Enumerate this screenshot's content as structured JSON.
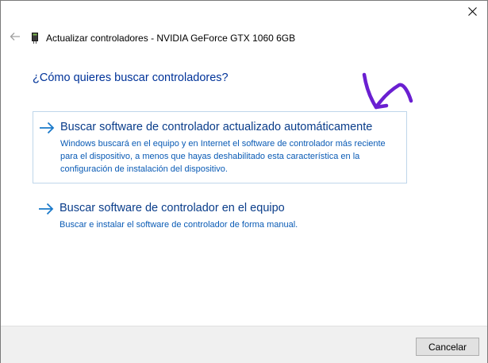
{
  "window": {
    "title": "Actualizar controladores - NVIDIA GeForce GTX 1060 6GB"
  },
  "icons": {
    "close": "close-icon",
    "back": "back-arrow-icon",
    "device": "device-driver-icon",
    "option_arrow": "right-arrow-icon",
    "annotation": "hand-drawn-arrow-annotation"
  },
  "main": {
    "question": "¿Cómo quieres buscar controladores?",
    "options": [
      {
        "title": "Buscar software de controlador actualizado automáticamente",
        "description": "Windows buscará en el equipo y en Internet el software de controlador más reciente para el dispositivo, a menos que hayas deshabilitado esta característica en la configuración de instalación del dispositivo."
      },
      {
        "title": "Buscar software de controlador en el equipo",
        "description": "Buscar e instalar el software de controlador de forma manual."
      }
    ]
  },
  "footer": {
    "cancel_label": "Cancelar"
  },
  "colors": {
    "heading": "#003399",
    "option_title": "#0a3d8a",
    "option_desc": "#0a5bb5",
    "arrow": "#1979ca",
    "annotation": "#6a1fd1",
    "selection_border": "#bfd6ea"
  }
}
